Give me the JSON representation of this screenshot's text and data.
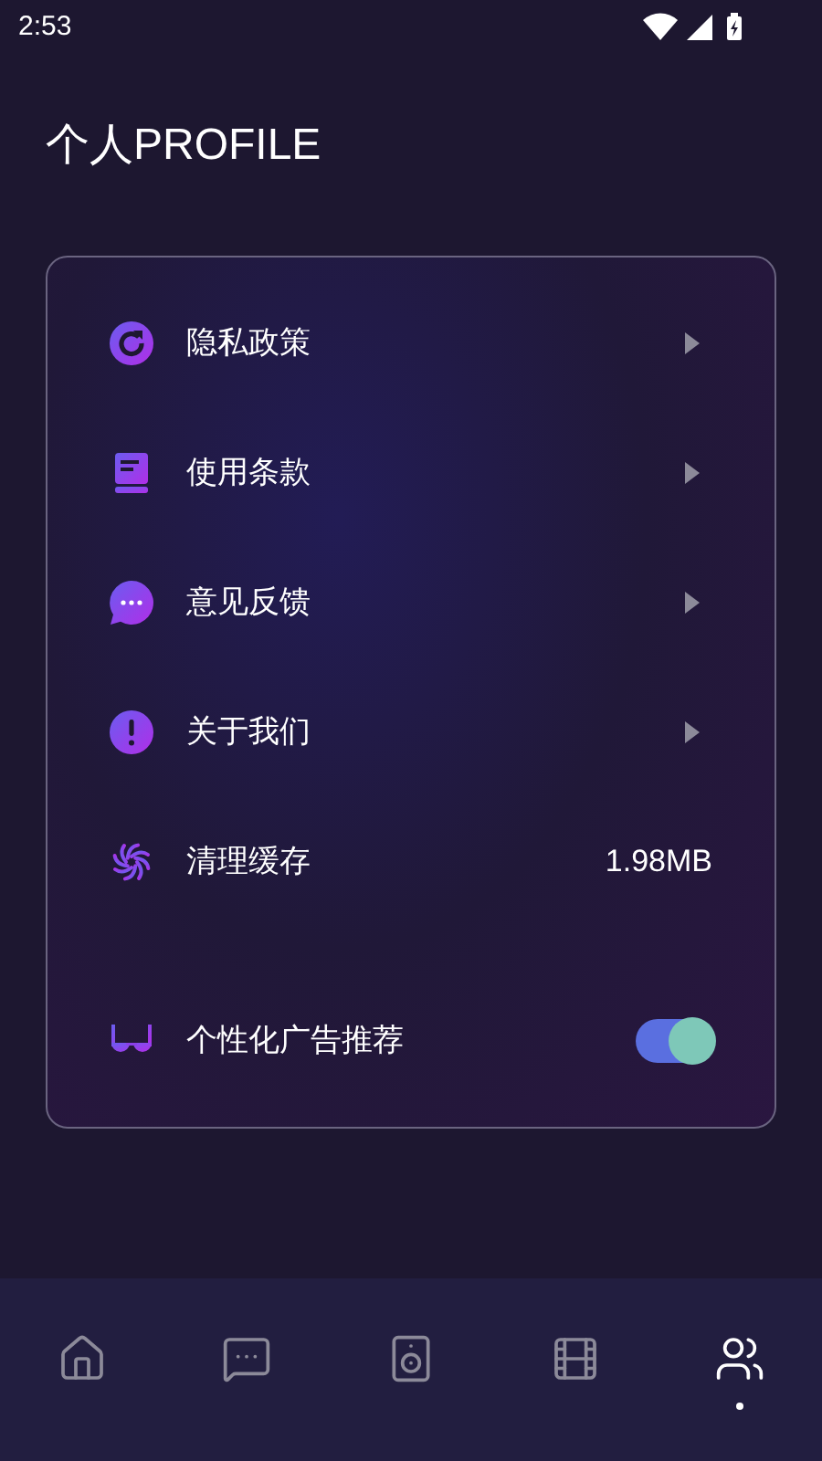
{
  "status_bar": {
    "time": "2:53"
  },
  "title": "个人PROFILE",
  "items": [
    {
      "kind": "link",
      "label": "隐私政策"
    },
    {
      "kind": "link",
      "label": "使用条款"
    },
    {
      "kind": "link",
      "label": "意见反馈"
    },
    {
      "kind": "link",
      "label": "关于我们"
    },
    {
      "kind": "value",
      "label": "清理缓存",
      "value": "1.98MB"
    },
    {
      "kind": "toggle",
      "label": "个性化广告推荐",
      "on": true
    }
  ],
  "nav": [
    {
      "selected": false
    },
    {
      "selected": false
    },
    {
      "selected": false
    },
    {
      "selected": false
    },
    {
      "selected": true
    }
  ]
}
